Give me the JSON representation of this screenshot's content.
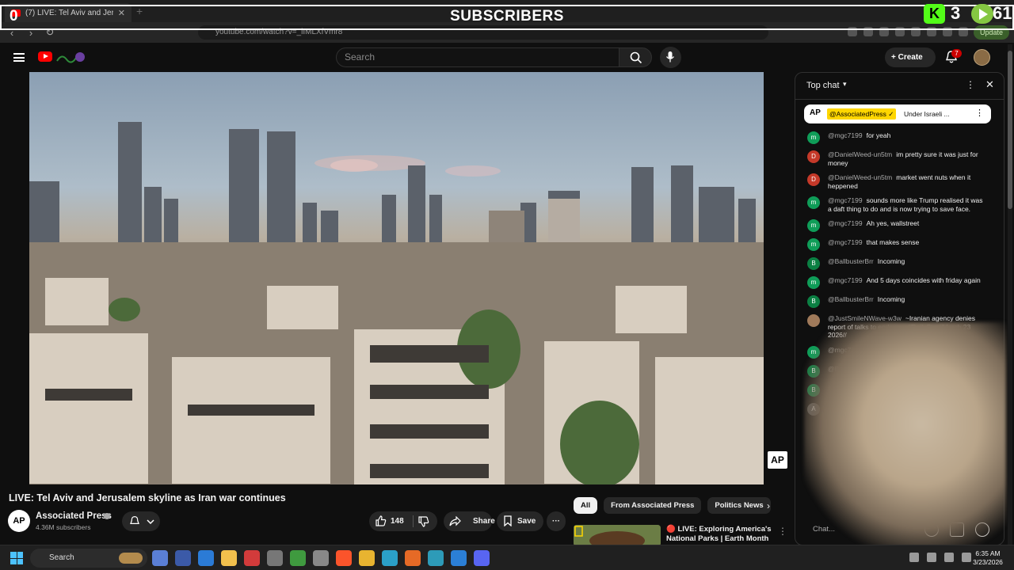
{
  "browser": {
    "tab_title": "(7) LIVE: Tel Aviv and Jerusale...",
    "url": "youtube.com/watch?v=_iIMLXfVmr8",
    "update_label": "Update"
  },
  "overlay": {
    "title": "SUBSCRIBERS",
    "left_count": "0",
    "kick_label": "K",
    "kick_count": "3",
    "rumble_count": "61"
  },
  "header": {
    "search_placeholder": "Search",
    "create_label": "+ Create",
    "notification_count": "7"
  },
  "video": {
    "title": "LIVE: Tel Aviv and Jerusalem skyline as Iran war continues",
    "watermark": "AP",
    "channel_avatar": "AP",
    "channel_name": "Associated Press",
    "subscribers": "4.36M subscribers",
    "like_count": "148",
    "share_label": "Share",
    "save_label": "Save",
    "more_label": "···"
  },
  "recommendations": {
    "chips": [
      "All",
      "From Associated Press",
      "Politics News"
    ],
    "next_label": "›",
    "item_title": "🔴 LIVE: Exploring America's National Parks | Earth Month ..."
  },
  "chat": {
    "header_label": "Top chat",
    "pinned": {
      "avatar": "AP",
      "author": "@AssociatedPress ✓",
      "message": "Under Israeli ..."
    },
    "input_placeholder": "Chat...",
    "messages": [
      {
        "initial": "m",
        "color": "#0f9d58",
        "author": "@mgc7199",
        "text": "for yeah"
      },
      {
        "initial": "D",
        "color": "#c53929",
        "author": "@DanielWeed-un5tm",
        "text": "im pretty sure it was just for money"
      },
      {
        "initial": "D",
        "color": "#c53929",
        "author": "@DanielWeed-un5tm",
        "text": "market went nuts when it heppened"
      },
      {
        "initial": "m",
        "color": "#0f9d58",
        "author": "@mgc7199",
        "text": "sounds more like Trump realised it was a daft thing to do and is now trying to save face."
      },
      {
        "initial": "m",
        "color": "#0f9d58",
        "author": "@mgc7199",
        "text": "Ah yes, wallstreet"
      },
      {
        "initial": "m",
        "color": "#0f9d58",
        "author": "@mgc7199",
        "text": "that makes sense"
      },
      {
        "initial": "B",
        "color": "#0b8043",
        "author": "@BallbusterBrr",
        "text": "Incoming"
      },
      {
        "initial": "m",
        "color": "#0f9d58",
        "author": "@mgc7199",
        "text": "And 5 days coincides with friday again"
      },
      {
        "initial": "B",
        "color": "#0b8043",
        "author": "@BallbusterBrr",
        "text": "Incoming"
      },
      {
        "initial": "",
        "color": "#a07a5a",
        "author": "@JustSmileNWave-w3w",
        "text": "~Iranian agency denies report of talks to end war~ //DailyStar//March 23 2026//"
      },
      {
        "initial": "m",
        "color": "#0f9d58",
        "author": "@mgc7199",
        "text": "yup"
      },
      {
        "initial": "B",
        "color": "#0b8043",
        "author": "@BallbusterBrr",
        "text": "Ye"
      },
      {
        "initial": "B",
        "color": "#0b8043",
        "author": "@Ballbu",
        "text": ""
      },
      {
        "initial": "A",
        "color": "#555555",
        "author": "",
        "text": ""
      }
    ]
  },
  "taskbar": {
    "search_label": "Search",
    "time": "6:35 AM",
    "date": "3/23/2026"
  }
}
